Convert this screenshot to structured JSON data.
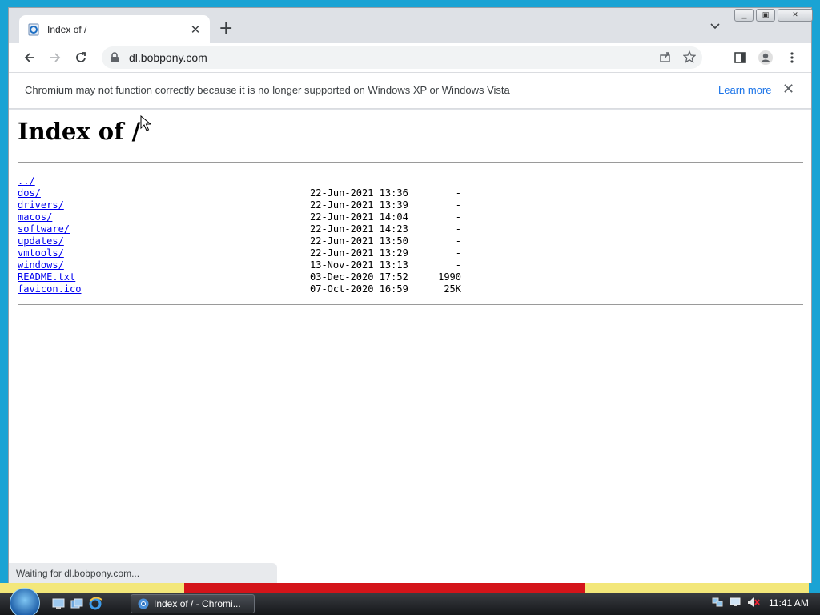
{
  "browser": {
    "tab_title": "Index of /",
    "url": "dl.bobpony.com",
    "infobar_message": "Chromium may not function correctly because it is no longer supported on Windows XP or Windows Vista",
    "infobar_link": "Learn more",
    "status_text": "Waiting for dl.bobpony.com..."
  },
  "page": {
    "heading": "Index of /",
    "parent_link": "../",
    "entries": [
      {
        "name": "dos/",
        "date": "22-Jun-2021 13:36",
        "size": "-"
      },
      {
        "name": "drivers/",
        "date": "22-Jun-2021 13:39",
        "size": "-"
      },
      {
        "name": "macos/",
        "date": "22-Jun-2021 14:04",
        "size": "-"
      },
      {
        "name": "software/",
        "date": "22-Jun-2021 14:23",
        "size": "-"
      },
      {
        "name": "updates/",
        "date": "22-Jun-2021 13:50",
        "size": "-"
      },
      {
        "name": "vmtools/",
        "date": "22-Jun-2021 13:29",
        "size": "-"
      },
      {
        "name": "windows/",
        "date": "13-Nov-2021 13:13",
        "size": "-"
      },
      {
        "name": "README.txt",
        "date": "03-Dec-2020 17:52",
        "size": "1990"
      },
      {
        "name": "favicon.ico",
        "date": "07-Oct-2020 16:59",
        "size": "25K"
      }
    ]
  },
  "taskbar": {
    "task_label": "Index of / - Chromi...",
    "clock": "11:41 AM"
  },
  "colors": {
    "link": "#0000ee",
    "accent": "#1a73e8",
    "desktop": "#1aa3d4"
  }
}
